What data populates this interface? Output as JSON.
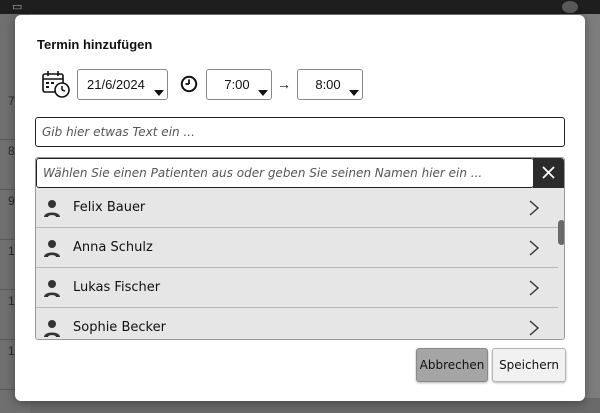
{
  "background": {
    "hours": [
      "7",
      "8",
      "9",
      "10",
      "1",
      "1",
      "1"
    ]
  },
  "dialog": {
    "title": "Termin hinzufügen",
    "date": {
      "value": "21/6/2024",
      "icon": "calendar-clock-icon"
    },
    "start_time": {
      "value": "7:00",
      "icon": "clock-icon"
    },
    "arrow": "→",
    "end_time": {
      "value": "8:00"
    },
    "text_input": {
      "placeholder": "Gib hier etwas Text ein ..."
    },
    "patient_search": {
      "placeholder": "Wählen Sie einen Patienten aus oder geben Sie seinen Namen hier ein ...",
      "clear_icon": "close-icon"
    },
    "patients": [
      {
        "name": "Felix Bauer"
      },
      {
        "name": "Anna Schulz"
      },
      {
        "name": "Lukas Fischer"
      },
      {
        "name": "Sophie Becker"
      }
    ],
    "buttons": {
      "cancel": "Abbrechen",
      "save": "Speichern"
    }
  },
  "colors": {
    "overlay": "#7a7a7a",
    "list_bg": "#e6e6e6",
    "clear_button": "#2b2b2b",
    "cancel_button": "#a5a5a5"
  }
}
